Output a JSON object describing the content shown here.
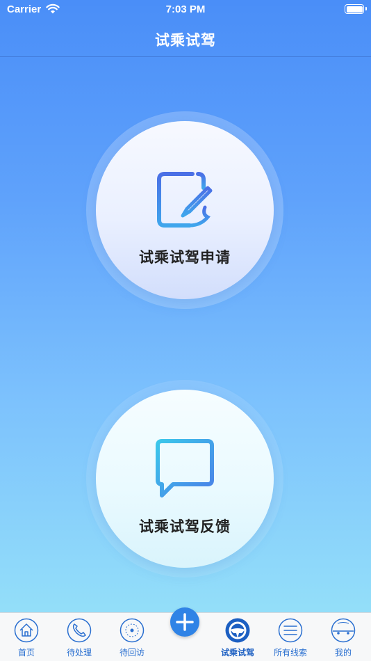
{
  "status_bar": {
    "carrier": "Carrier",
    "time": "7:03 PM"
  },
  "nav": {
    "title": "试乘试驾"
  },
  "actions": [
    {
      "label": "试乘试驾申请",
      "icon": "edit-document-icon"
    },
    {
      "label": "试乘试驾反馈",
      "icon": "message-bubble-icon"
    }
  ],
  "tabs": [
    {
      "label": "首页",
      "icon": "home-icon"
    },
    {
      "label": "待处理",
      "icon": "phone-icon"
    },
    {
      "label": "待回访",
      "icon": "revisit-icon"
    },
    {
      "label": "",
      "icon": "add-icon"
    },
    {
      "label": "试乘试驾",
      "icon": "steering-wheel-icon",
      "active": true
    },
    {
      "label": "所有线索",
      "icon": "list-icon"
    },
    {
      "label": "我的",
      "icon": "car-profile-icon"
    }
  ],
  "colors": {
    "accent": "#2f83e6",
    "gradient_top": "#4a8ef8",
    "gradient_bottom": "#95e2f8"
  }
}
